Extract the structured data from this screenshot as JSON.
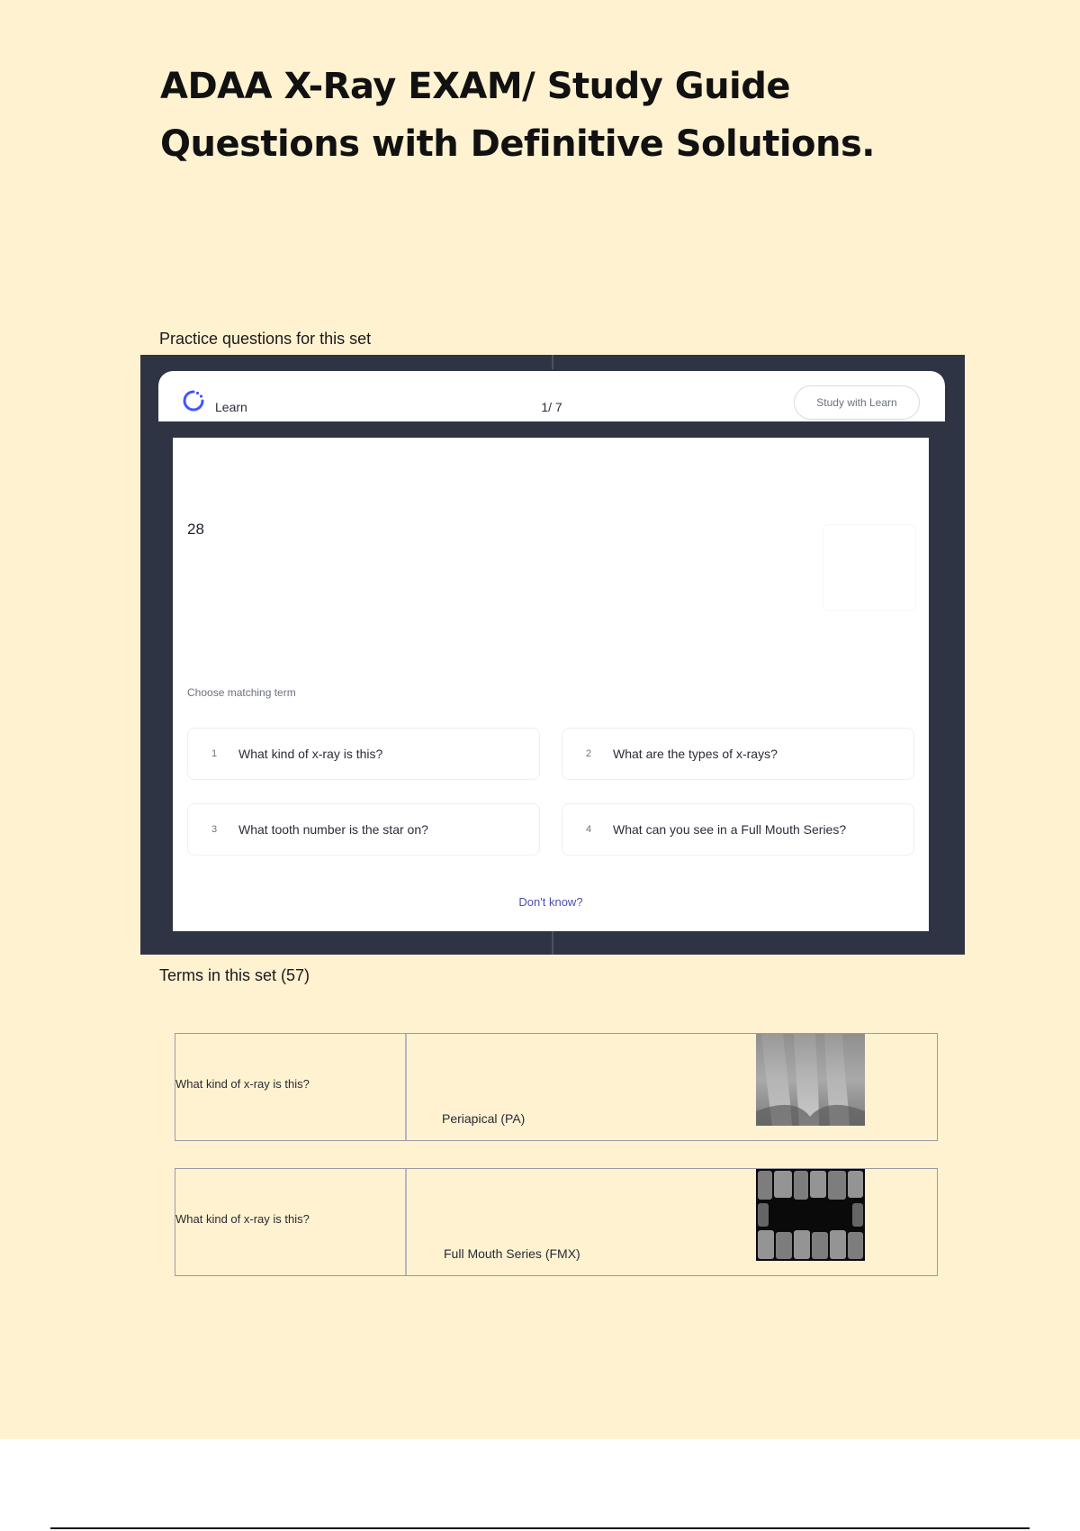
{
  "document": {
    "title": "ADAA X-Ray EXAM/ Study Guide Questions with Definitive Solutions."
  },
  "practice": {
    "section_label": "Practice questions for this set",
    "learn": {
      "mode_label": "Learn",
      "counter": "1/ 7",
      "study_button_label": "Study with Learn"
    },
    "prompt": "28",
    "choose_label": "Choose matching term",
    "options": [
      {
        "num": "1",
        "text": "What kind of x-ray is this?"
      },
      {
        "num": "2",
        "text": "What are the types of x-rays?"
      },
      {
        "num": "3",
        "text": "What tooth number is the star on?"
      },
      {
        "num": "4",
        "text": "What can you see in a Full Mouth Series?"
      }
    ],
    "dont_know_label": "Don't know?"
  },
  "terms": {
    "section_label": "Terms in this set (57)",
    "items": [
      {
        "question": "What kind of x-ray is this?",
        "answer": "Periapical (PA)"
      },
      {
        "question": "What kind of x-ray is this?",
        "answer": "Full Mouth Series (FMX)"
      }
    ]
  },
  "colors": {
    "page_background": "#fff2d1",
    "frame_background": "#2f3445",
    "accent": "#4a4fb0"
  }
}
